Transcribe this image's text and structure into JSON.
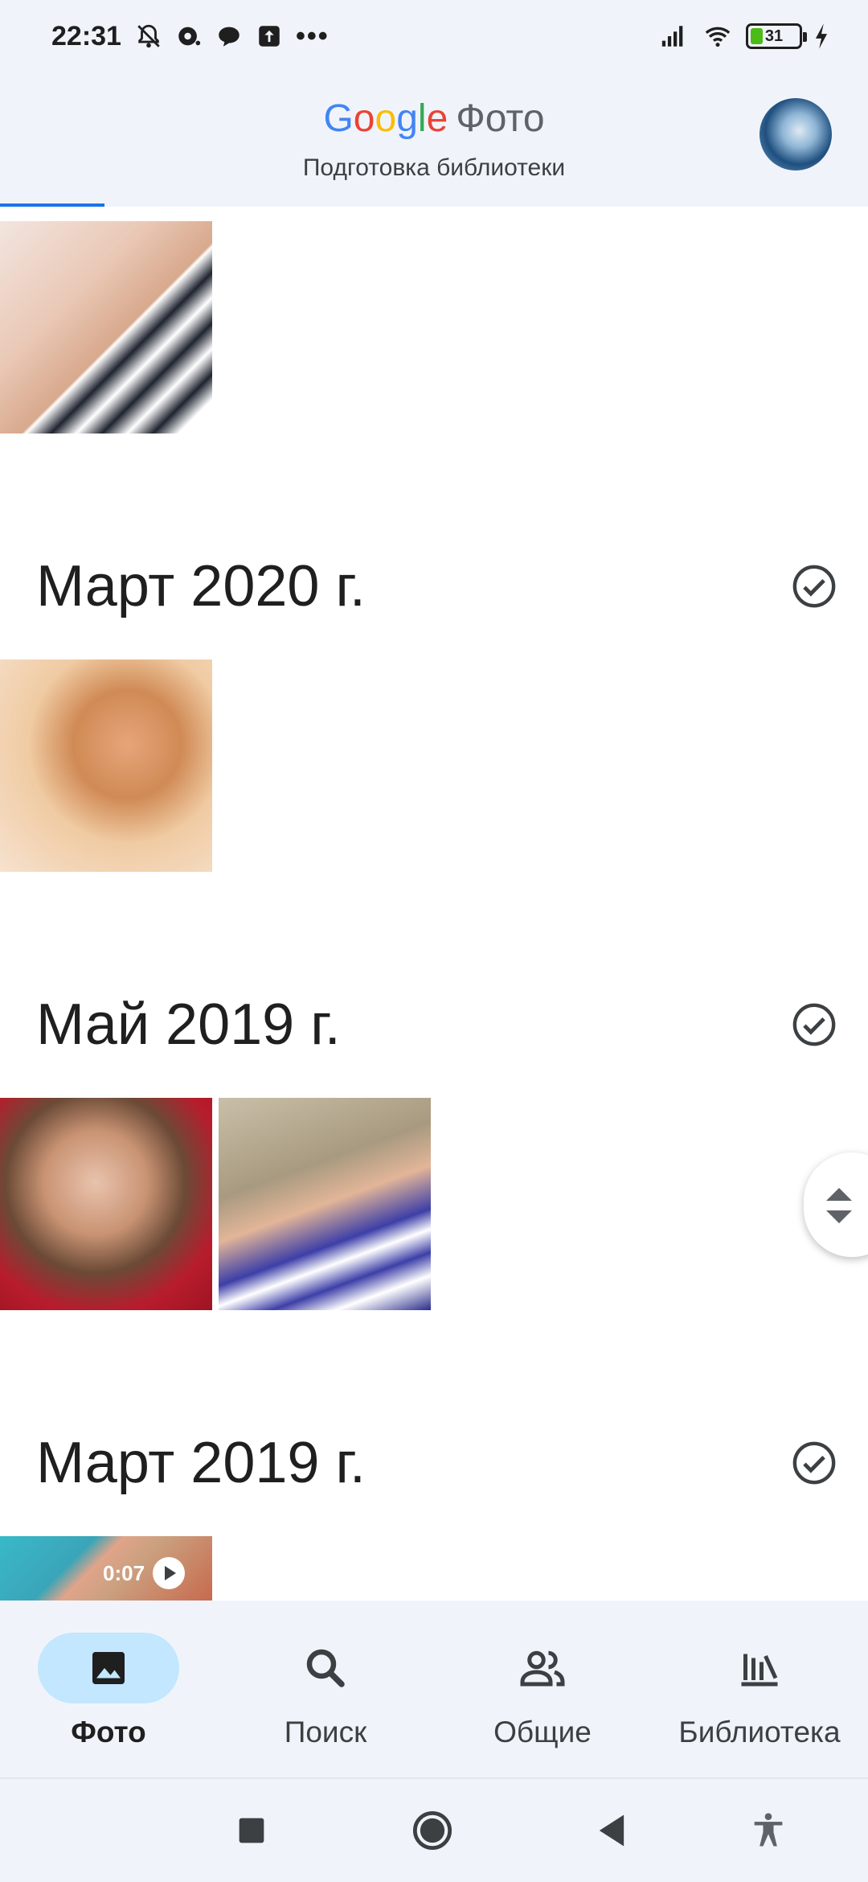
{
  "status_bar": {
    "time": "22:31",
    "overflow": "•••",
    "battery_level": "31",
    "icons_left": [
      "muted-bell-icon",
      "notification-icon",
      "chat-icon",
      "upload-icon"
    ],
    "icons_right": [
      "signal-icon",
      "wifi-icon",
      "battery-icon",
      "charging-icon"
    ]
  },
  "header": {
    "brand_letters": [
      {
        "ch": "G",
        "color": "#4285F4"
      },
      {
        "ch": "o",
        "color": "#EA4335"
      },
      {
        "ch": "o",
        "color": "#FBBC05"
      },
      {
        "ch": "g",
        "color": "#4285F4"
      },
      {
        "ch": "l",
        "color": "#34A853"
      },
      {
        "ch": "e",
        "color": "#EA4335"
      }
    ],
    "product": "Фото",
    "subtitle": "Подготовка библиотеки",
    "progress": 0.12
  },
  "sections": [
    {
      "title": "Март 2020 г."
    },
    {
      "title": "Май 2019 г."
    },
    {
      "title": "Март 2019 г."
    }
  ],
  "video": {
    "duration": "0:07"
  },
  "nav": {
    "items": [
      {
        "label": "Фото",
        "icon": "photo-icon",
        "active": true
      },
      {
        "label": "Поиск",
        "icon": "search-icon",
        "active": false
      },
      {
        "label": "Общие",
        "icon": "people-icon",
        "active": false
      },
      {
        "label": "Библиотека",
        "icon": "library-icon",
        "active": false
      }
    ]
  },
  "system_nav": [
    "recents-icon",
    "home-icon",
    "back-icon",
    "accessibility-icon"
  ],
  "colors": {
    "header_bg": "#f0f4fa",
    "accent": "#1a73e8",
    "active_pill": "#c2e7ff"
  }
}
